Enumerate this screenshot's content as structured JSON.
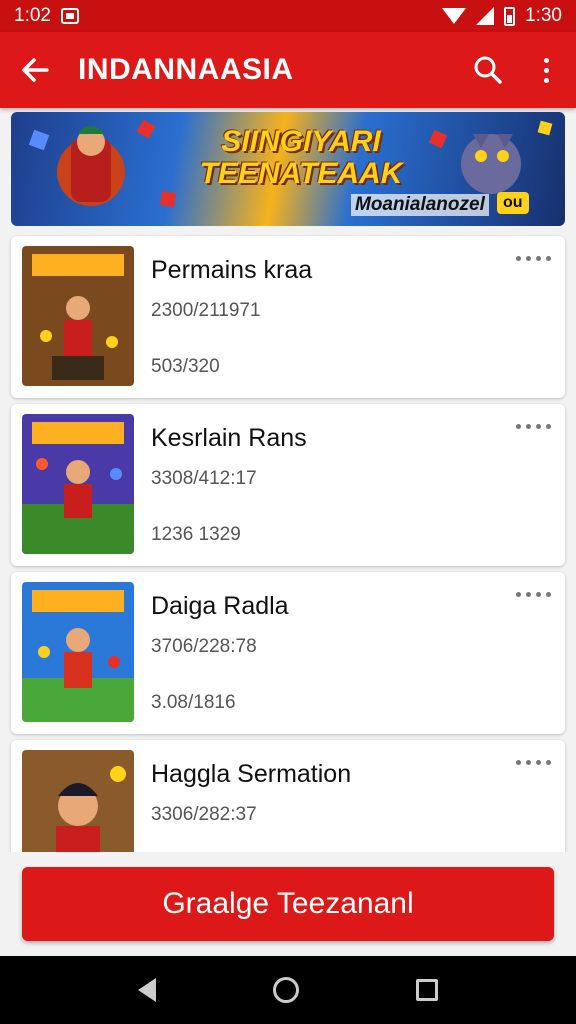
{
  "status_bar": {
    "time_left": "1:02",
    "time_right": "1:30"
  },
  "app_bar": {
    "title": "INDANNAASIA",
    "back_icon": "arrow-left-icon",
    "search_icon": "search-icon",
    "more_icon": "more-vert-icon"
  },
  "banner": {
    "title_line1": "SIINGIYARI",
    "title_line2": "TEENATEAAK",
    "subtitle": "Moanialanozel",
    "badge": "ou"
  },
  "items": [
    {
      "title": "Permains kraa",
      "line1": "2300/211971",
      "line2": "503/320"
    },
    {
      "title": "Kesrlain Rans",
      "line1": "3308/412:17",
      "line2": "1236 1329"
    },
    {
      "title": "Daiga Radla",
      "line1": "3706/228:78",
      "line2": "3.08/1816"
    },
    {
      "title": "Haggla Sermation",
      "line1": "3306/282:37",
      "line2": ""
    }
  ],
  "cta": {
    "label": "Graalge Teezananl"
  },
  "colors": {
    "primary": "#dc1818",
    "status": "#c81010"
  }
}
